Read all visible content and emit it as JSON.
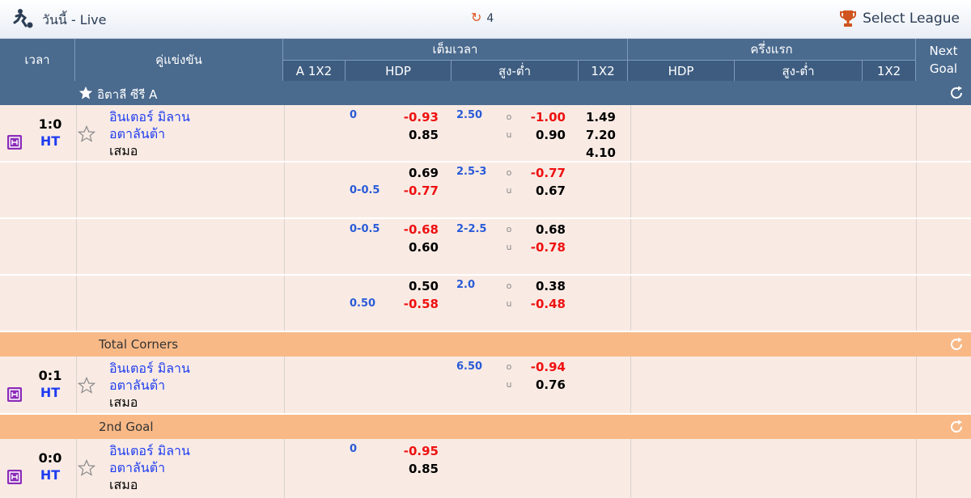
{
  "topbar": {
    "title": "วันนี้ - Live",
    "refresh_count": "4",
    "select_league": "Select League",
    "icons": [
      "soccer-player-icon",
      "refresh-icon",
      "trophy-icon"
    ]
  },
  "header": {
    "time": "เวลา",
    "match": "คู่แข่งขัน",
    "fulltime": "เต็มเวลา",
    "firsthalf": "ครึ่งแรก",
    "next_goal": "Next Goal",
    "ft_cols": [
      "A 1X2",
      "HDP",
      "สูง-ต่ำ",
      "1X2"
    ],
    "fh_cols": [
      "HDP",
      "สูง-ต่ำ",
      "1X2"
    ]
  },
  "league": {
    "name": "อิตาลี ซีรี A"
  },
  "sections": {
    "corners": "Total Corners",
    "second_goal": "2nd Goal"
  },
  "teams": {
    "home": "อินเตอร์ มิลาน",
    "away": "อตาลันต้า",
    "draw": "เสมอ"
  },
  "ou_labels": {
    "over": "o",
    "under": "u"
  },
  "matches": [
    {
      "score": "1:0",
      "status": "HT"
    },
    {
      "score": "0:1",
      "status": "HT"
    },
    {
      "score": "0:0",
      "status": "HT"
    }
  ],
  "main": {
    "r1": {
      "hdp_line": "0",
      "hdp_home": "-0.93",
      "hdp_away": "0.85",
      "ou_line": "2.50",
      "ou_over": "-1.00",
      "ou_under": "0.90",
      "x12_1": "1.49",
      "x12_2": "7.20",
      "x12_x": "4.10"
    },
    "r2": {
      "hdp_line": "0-0.5",
      "hdp_home": "0.69",
      "hdp_away": "-0.77",
      "ou_line": "2.5-3",
      "ou_over": "-0.77",
      "ou_under": "0.67"
    },
    "r3": {
      "hdp_line": "0-0.5",
      "hdp_home": "-0.68",
      "hdp_away": "0.60",
      "ou_line": "2-2.5",
      "ou_over": "0.68",
      "ou_under": "-0.78"
    },
    "r4": {
      "hdp_line": "0.50",
      "hdp_home": "0.50",
      "hdp_away": "-0.58",
      "ou_line": "2.0",
      "ou_over": "0.38",
      "ou_under": "-0.48"
    }
  },
  "corners": {
    "ou_line": "6.50",
    "ou_over": "-0.94",
    "ou_under": "0.76"
  },
  "second_goal": {
    "hdp_line": "0",
    "hdp_home": "-0.95",
    "hdp_away": "0.85"
  },
  "colors": {
    "header": "#4a6a8e",
    "section": "#f8b987",
    "row": "#f9ebe4",
    "team": "#1e3cf0",
    "negative": "#ee1111",
    "line": "#2a5bd7"
  }
}
